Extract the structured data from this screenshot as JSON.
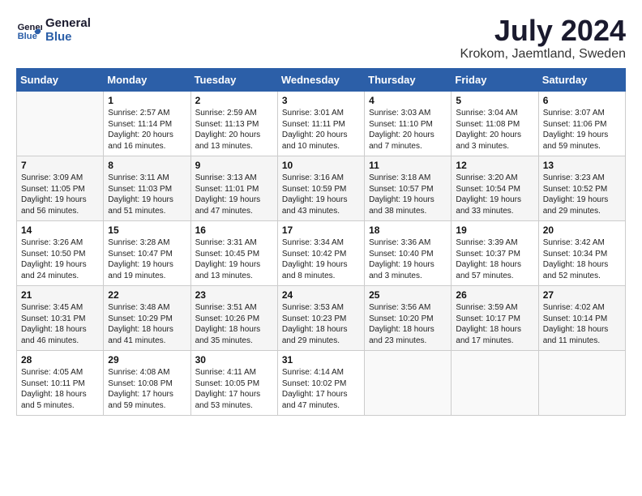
{
  "header": {
    "logo_line1": "General",
    "logo_line2": "Blue",
    "month_title": "July 2024",
    "location": "Krokom, Jaemtland, Sweden"
  },
  "weekdays": [
    "Sunday",
    "Monday",
    "Tuesday",
    "Wednesday",
    "Thursday",
    "Friday",
    "Saturday"
  ],
  "weeks": [
    [
      {
        "day": "",
        "sunrise": "",
        "sunset": "",
        "daylight": ""
      },
      {
        "day": "1",
        "sunrise": "Sunrise: 2:57 AM",
        "sunset": "Sunset: 11:14 PM",
        "daylight": "Daylight: 20 hours and 16 minutes."
      },
      {
        "day": "2",
        "sunrise": "Sunrise: 2:59 AM",
        "sunset": "Sunset: 11:13 PM",
        "daylight": "Daylight: 20 hours and 13 minutes."
      },
      {
        "day": "3",
        "sunrise": "Sunrise: 3:01 AM",
        "sunset": "Sunset: 11:11 PM",
        "daylight": "Daylight: 20 hours and 10 minutes."
      },
      {
        "day": "4",
        "sunrise": "Sunrise: 3:03 AM",
        "sunset": "Sunset: 11:10 PM",
        "daylight": "Daylight: 20 hours and 7 minutes."
      },
      {
        "day": "5",
        "sunrise": "Sunrise: 3:04 AM",
        "sunset": "Sunset: 11:08 PM",
        "daylight": "Daylight: 20 hours and 3 minutes."
      },
      {
        "day": "6",
        "sunrise": "Sunrise: 3:07 AM",
        "sunset": "Sunset: 11:06 PM",
        "daylight": "Daylight: 19 hours and 59 minutes."
      }
    ],
    [
      {
        "day": "7",
        "sunrise": "Sunrise: 3:09 AM",
        "sunset": "Sunset: 11:05 PM",
        "daylight": "Daylight: 19 hours and 56 minutes."
      },
      {
        "day": "8",
        "sunrise": "Sunrise: 3:11 AM",
        "sunset": "Sunset: 11:03 PM",
        "daylight": "Daylight: 19 hours and 51 minutes."
      },
      {
        "day": "9",
        "sunrise": "Sunrise: 3:13 AM",
        "sunset": "Sunset: 11:01 PM",
        "daylight": "Daylight: 19 hours and 47 minutes."
      },
      {
        "day": "10",
        "sunrise": "Sunrise: 3:16 AM",
        "sunset": "Sunset: 10:59 PM",
        "daylight": "Daylight: 19 hours and 43 minutes."
      },
      {
        "day": "11",
        "sunrise": "Sunrise: 3:18 AM",
        "sunset": "Sunset: 10:57 PM",
        "daylight": "Daylight: 19 hours and 38 minutes."
      },
      {
        "day": "12",
        "sunrise": "Sunrise: 3:20 AM",
        "sunset": "Sunset: 10:54 PM",
        "daylight": "Daylight: 19 hours and 33 minutes."
      },
      {
        "day": "13",
        "sunrise": "Sunrise: 3:23 AM",
        "sunset": "Sunset: 10:52 PM",
        "daylight": "Daylight: 19 hours and 29 minutes."
      }
    ],
    [
      {
        "day": "14",
        "sunrise": "Sunrise: 3:26 AM",
        "sunset": "Sunset: 10:50 PM",
        "daylight": "Daylight: 19 hours and 24 minutes."
      },
      {
        "day": "15",
        "sunrise": "Sunrise: 3:28 AM",
        "sunset": "Sunset: 10:47 PM",
        "daylight": "Daylight: 19 hours and 19 minutes."
      },
      {
        "day": "16",
        "sunrise": "Sunrise: 3:31 AM",
        "sunset": "Sunset: 10:45 PM",
        "daylight": "Daylight: 19 hours and 13 minutes."
      },
      {
        "day": "17",
        "sunrise": "Sunrise: 3:34 AM",
        "sunset": "Sunset: 10:42 PM",
        "daylight": "Daylight: 19 hours and 8 minutes."
      },
      {
        "day": "18",
        "sunrise": "Sunrise: 3:36 AM",
        "sunset": "Sunset: 10:40 PM",
        "daylight": "Daylight: 19 hours and 3 minutes."
      },
      {
        "day": "19",
        "sunrise": "Sunrise: 3:39 AM",
        "sunset": "Sunset: 10:37 PM",
        "daylight": "Daylight: 18 hours and 57 minutes."
      },
      {
        "day": "20",
        "sunrise": "Sunrise: 3:42 AM",
        "sunset": "Sunset: 10:34 PM",
        "daylight": "Daylight: 18 hours and 52 minutes."
      }
    ],
    [
      {
        "day": "21",
        "sunrise": "Sunrise: 3:45 AM",
        "sunset": "Sunset: 10:31 PM",
        "daylight": "Daylight: 18 hours and 46 minutes."
      },
      {
        "day": "22",
        "sunrise": "Sunrise: 3:48 AM",
        "sunset": "Sunset: 10:29 PM",
        "daylight": "Daylight: 18 hours and 41 minutes."
      },
      {
        "day": "23",
        "sunrise": "Sunrise: 3:51 AM",
        "sunset": "Sunset: 10:26 PM",
        "daylight": "Daylight: 18 hours and 35 minutes."
      },
      {
        "day": "24",
        "sunrise": "Sunrise: 3:53 AM",
        "sunset": "Sunset: 10:23 PM",
        "daylight": "Daylight: 18 hours and 29 minutes."
      },
      {
        "day": "25",
        "sunrise": "Sunrise: 3:56 AM",
        "sunset": "Sunset: 10:20 PM",
        "daylight": "Daylight: 18 hours and 23 minutes."
      },
      {
        "day": "26",
        "sunrise": "Sunrise: 3:59 AM",
        "sunset": "Sunset: 10:17 PM",
        "daylight": "Daylight: 18 hours and 17 minutes."
      },
      {
        "day": "27",
        "sunrise": "Sunrise: 4:02 AM",
        "sunset": "Sunset: 10:14 PM",
        "daylight": "Daylight: 18 hours and 11 minutes."
      }
    ],
    [
      {
        "day": "28",
        "sunrise": "Sunrise: 4:05 AM",
        "sunset": "Sunset: 10:11 PM",
        "daylight": "Daylight: 18 hours and 5 minutes."
      },
      {
        "day": "29",
        "sunrise": "Sunrise: 4:08 AM",
        "sunset": "Sunset: 10:08 PM",
        "daylight": "Daylight: 17 hours and 59 minutes."
      },
      {
        "day": "30",
        "sunrise": "Sunrise: 4:11 AM",
        "sunset": "Sunset: 10:05 PM",
        "daylight": "Daylight: 17 hours and 53 minutes."
      },
      {
        "day": "31",
        "sunrise": "Sunrise: 4:14 AM",
        "sunset": "Sunset: 10:02 PM",
        "daylight": "Daylight: 17 hours and 47 minutes."
      },
      {
        "day": "",
        "sunrise": "",
        "sunset": "",
        "daylight": ""
      },
      {
        "day": "",
        "sunrise": "",
        "sunset": "",
        "daylight": ""
      },
      {
        "day": "",
        "sunrise": "",
        "sunset": "",
        "daylight": ""
      }
    ]
  ]
}
